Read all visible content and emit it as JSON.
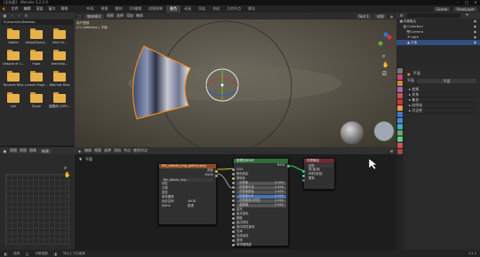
{
  "window": {
    "title": "[无标题] - Blender 3.2.2.0"
  },
  "menubar": {
    "menus": [
      "文件",
      "编辑",
      "渲染",
      "窗口",
      "帮助"
    ],
    "workspaces": [
      "布局",
      "建模",
      "雕刻",
      "UV编辑",
      "纹理绘制",
      "着色",
      "动画",
      "渲染",
      "合成",
      "几何节点",
      "脚本"
    ],
    "active_workspace": "着色",
    "scene_label": "Scene",
    "viewlayer_label": "ViewLayer"
  },
  "file_browser": {
    "path": "D:\\Users\\kk\\Desktop\\",
    "items": [
      {
        "label": "Adobe"
      },
      {
        "label": "AdoptOpenJ..."
      },
      {
        "label": "Intel Gr..."
      },
      {
        "label": "League of L..."
      },
      {
        "label": "hapa"
      },
      {
        "label": "bandizip..."
      },
      {
        "label": "Tencent Files"
      },
      {
        "label": "Juvenil Proje..."
      },
      {
        "label": "WeChat Files"
      },
      {
        "label": "nplr"
      },
      {
        "label": "Zoom"
      },
      {
        "label": "蓝叠网 (Offli..."
      }
    ]
  },
  "viewport": {
    "view_label": "用户透视",
    "collection_label": "(1) Collection | 平面",
    "mode": "物体模式",
    "menu": [
      "视图",
      "选择",
      "添加",
      "物体"
    ],
    "shading_slot": "Slot 1",
    "material_dropdown": "材质"
  },
  "image_editor": {
    "menu": [
      "视图",
      "视图",
      "图像"
    ],
    "zoom": "新建"
  },
  "node_editor": {
    "menu": [
      "物体",
      "视图",
      "选择",
      "添加",
      "节点"
    ],
    "use_nodes": "使用节点",
    "slot": "平面",
    "image_node": {
      "title": "Bfs_albedo_img_gallery.png",
      "outputs": [
        "颜色",
        "Alpha"
      ],
      "image_name": "Bfs_albedo_img...",
      "rows": [
        "线性",
        "平展",
        "重复",
        "单张图像",
        "色彩空间",
        "Alpha"
      ],
      "colorspace_value": "sRGB",
      "alpha_value": "直通"
    },
    "bsdf_node": {
      "title": "原理化BSDF",
      "output": "BSDF",
      "rows": [
        "GGX",
        "随机游走",
        "基础色",
        "次表面",
        "次表面半径",
        "次表面颜色",
        "次表面IOR",
        "次表面各向异性",
        "金属度",
        "高光",
        "高光染色",
        "糙度",
        "各向异性",
        "各向异性旋转",
        "光泽",
        "光泽染色",
        "清漆",
        "清漆粗糙度"
      ],
      "values": [
        "0.000",
        "0.000",
        "1.400",
        "0.000",
        "0.500",
        "0.500"
      ]
    },
    "output_node": {
      "title": "材质输出",
      "target": "全部",
      "inputs": [
        "表(曲)面",
        "体积(音量)",
        "置换"
      ]
    }
  },
  "outliner": {
    "header": "场景集合",
    "items": [
      {
        "label": "场景集合"
      },
      {
        "label": "Collection"
      },
      {
        "label": "Camera"
      },
      {
        "label": "Light"
      },
      {
        "label": "平面"
      }
    ]
  },
  "properties": {
    "object_name": "平面",
    "sections": [
      "变换",
      "关系",
      "集合",
      "实例化",
      "可见性"
    ],
    "field_label": "平面",
    "field_value": "平面"
  },
  "statusbar": {
    "left": "选择",
    "mid": "平移视图",
    "mid2": "节点上下文菜单",
    "right": "3.2.2"
  },
  "colors": {
    "accent_orange": "#f08c1e",
    "folder": "#e6b04b",
    "node_image_header": "#8a4b20",
    "node_shader_header": "#2f6d3a",
    "node_output_header": "#6b2a35",
    "active_tab": "#3d3d3d"
  }
}
